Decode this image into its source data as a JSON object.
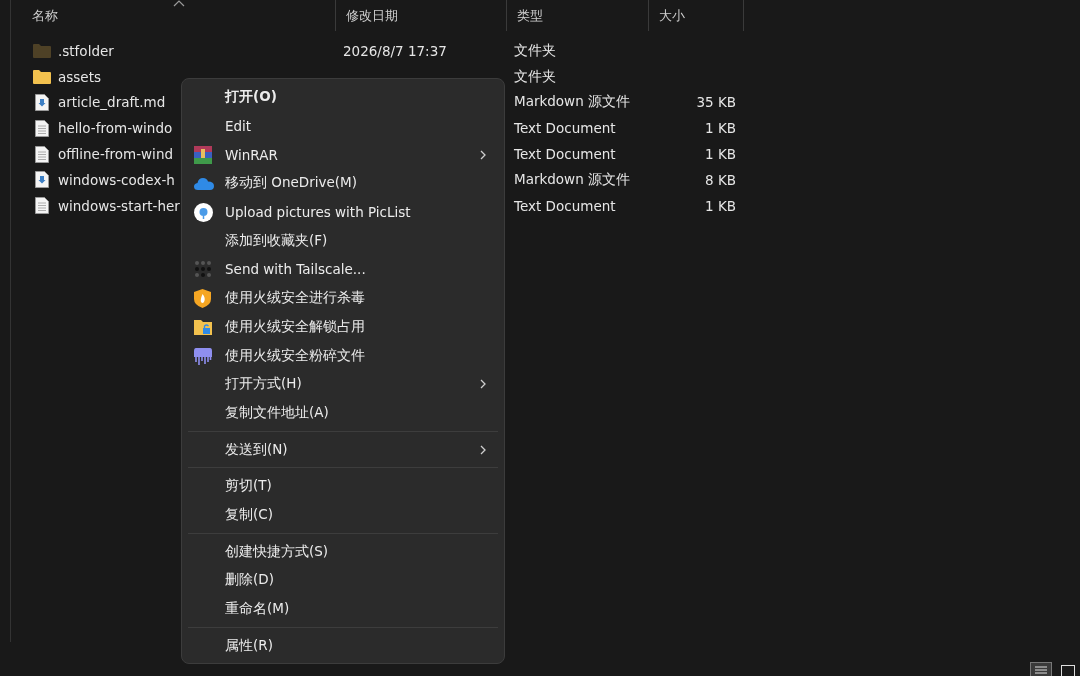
{
  "columns": [
    {
      "label": "名称",
      "sorted": true
    },
    {
      "label": "修改日期",
      "sorted": false
    },
    {
      "label": "类型",
      "sorted": false
    },
    {
      "label": "大小",
      "sorted": false
    }
  ],
  "rows": [
    {
      "name": ".stfolder",
      "kind": "folder",
      "hidden": true,
      "date": "2026/8/7 17:37",
      "type": "文件夹"
    },
    {
      "name": "assets",
      "kind": "folder",
      "hidden": false,
      "type": "文件夹"
    },
    {
      "name": "article_draft.md",
      "kind": "markdown",
      "hidden": false,
      "type": "Markdown 源文件",
      "size": "35 KB"
    },
    {
      "name": "hello-from-windo",
      "kind": "text",
      "hidden": false,
      "type": "Text Document",
      "size": "1 KB"
    },
    {
      "name": "offline-from-wind",
      "kind": "text",
      "hidden": false,
      "type": "Text Document",
      "size": "1 KB"
    },
    {
      "name": "windows-codex-h",
      "kind": "markdown",
      "hidden": false,
      "type": "Markdown 源文件",
      "size": "8 KB"
    },
    {
      "name": "windows-start-her",
      "kind": "text",
      "hidden": false,
      "type": "Text Document",
      "size": "1 KB"
    }
  ],
  "context_menu": {
    "sections": [
      [
        {
          "label": "打开(O)",
          "kind": "plain",
          "default": true,
          "submenu": false
        },
        {
          "label": "Edit",
          "kind": "plain",
          "default": false,
          "submenu": false
        },
        {
          "label": "WinRAR",
          "kind": "archive",
          "default": false,
          "submenu": true
        },
        {
          "label": "移动到 OneDrive(M)",
          "kind": "cloud",
          "default": false,
          "submenu": false
        },
        {
          "label": "Upload pictures with PicList",
          "kind": "upload",
          "default": false,
          "submenu": false
        },
        {
          "label": "添加到收藏夹(F)",
          "kind": "plain",
          "default": false,
          "submenu": false
        },
        {
          "label": "Send with Tailscale...",
          "kind": "dots",
          "default": false,
          "submenu": false
        },
        {
          "label": "使用火绒安全进行杀毒",
          "kind": "shield",
          "default": false,
          "submenu": false
        },
        {
          "label": "使用火绒安全解锁占用",
          "kind": "folder-lock",
          "default": false,
          "submenu": false
        },
        {
          "label": "使用火绒安全粉碎文件",
          "kind": "shredder",
          "default": false,
          "submenu": false
        },
        {
          "label": "打开方式(H)",
          "kind": "plain",
          "default": false,
          "submenu": true
        },
        {
          "label": "复制文件地址(A)",
          "kind": "plain",
          "default": false,
          "submenu": false
        }
      ],
      [
        {
          "label": "发送到(N)",
          "kind": "plain",
          "default": false,
          "submenu": true
        }
      ],
      [
        {
          "label": "剪切(T)",
          "kind": "plain",
          "default": false,
          "submenu": false
        },
        {
          "label": "复制(C)",
          "kind": "plain",
          "default": false,
          "submenu": false
        }
      ],
      [
        {
          "label": "创建快捷方式(S)",
          "kind": "plain",
          "default": false,
          "submenu": false
        },
        {
          "label": "删除(D)",
          "kind": "plain",
          "default": false,
          "submenu": false
        },
        {
          "label": "重命名(M)",
          "kind": "plain",
          "default": false,
          "submenu": false
        }
      ],
      [
        {
          "label": "属性(R)",
          "kind": "plain",
          "default": false,
          "submenu": false
        }
      ]
    ]
  }
}
